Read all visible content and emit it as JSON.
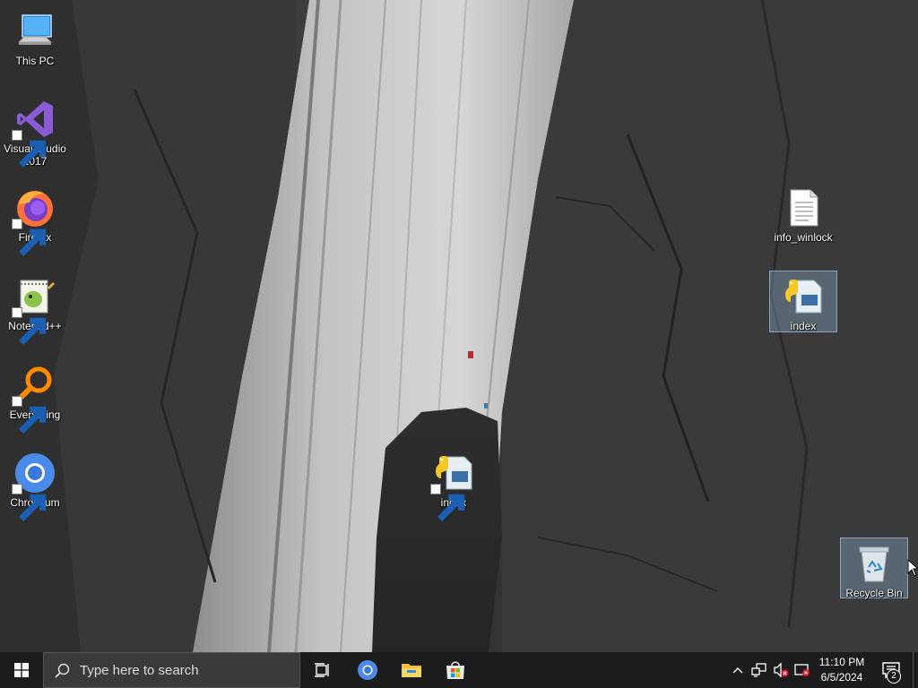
{
  "desktop": {
    "icons": [
      {
        "label": "This PC",
        "icon": "this-pc-icon"
      },
      {
        "label": "Visual Studio 2017",
        "icon": "visual-studio-icon"
      },
      {
        "label": "Firefox",
        "icon": "firefox-icon"
      },
      {
        "label": "Notepad++",
        "icon": "notepad-plus-plus-icon"
      },
      {
        "label": "Everything",
        "icon": "everything-icon"
      },
      {
        "label": "Chromium",
        "icon": "chromium-icon"
      },
      {
        "label": "index",
        "icon": "python-file-icon"
      },
      {
        "label": "info_winlock",
        "icon": "text-file-icon"
      },
      {
        "label": "index",
        "icon": "python-file-icon"
      },
      {
        "label": "Recycle Bin",
        "icon": "recycle-bin-icon"
      }
    ]
  },
  "taskbar": {
    "search_placeholder": "Type here to search",
    "pinned": [
      "task-view-icon",
      "chromium-icon",
      "file-explorer-icon",
      "store-icon"
    ],
    "clock": {
      "time": "11:10 PM",
      "date": "6/5/2024"
    },
    "notification_count": "2"
  },
  "colors": {
    "taskbar_bg": "#1c1c1c",
    "search_bg": "#3a3a3a",
    "accent": "#0078d7"
  }
}
